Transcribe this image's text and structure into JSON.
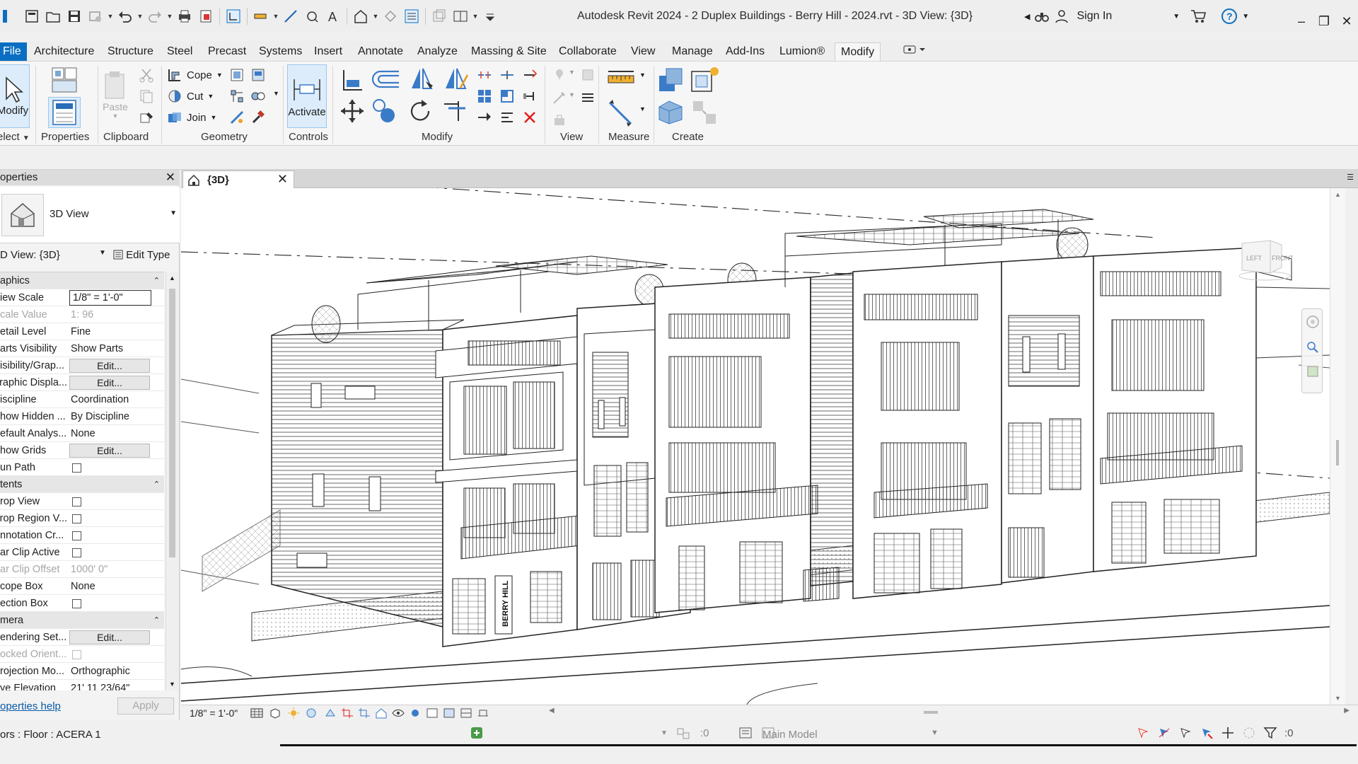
{
  "app": {
    "title": "Autodesk Revit 2024 - 2 Duplex Buildings - Berry Hill - 2024.rvt - 3D View: {3D}",
    "sign_in": "Sign In"
  },
  "ribbon": {
    "tabs": [
      "File",
      "Architecture",
      "Structure",
      "Steel",
      "Precast",
      "Systems",
      "Insert",
      "Annotate",
      "Analyze",
      "Massing & Site",
      "Collaborate",
      "View",
      "Manage",
      "Add-Ins",
      "Lumion®",
      "Modify"
    ],
    "active_tab": "Modify",
    "modify_label": "Modify",
    "select_label": "elect",
    "properties_label": "Properties",
    "paste_label": "Paste",
    "clipboard_label": "Clipboard",
    "cope_label": "Cope",
    "cut_label": "Cut",
    "join_label": "Join",
    "geometry_label": "Geometry",
    "activate_label": "Activate",
    "controls_label": "Controls",
    "modify_panel_label": "Modify",
    "view_panel_label": "View",
    "measure_label": "Measure",
    "create_label": "Create"
  },
  "properties": {
    "header": "operties",
    "type_name": "3D View",
    "view_selector": "D View: {3D}",
    "edit_type": "Edit Type",
    "rows": [
      {
        "kind": "section",
        "name": "aphics"
      },
      {
        "kind": "input",
        "name": "iew Scale",
        "value": "1/8\" = 1'-0\""
      },
      {
        "kind": "text",
        "name": "cale Value",
        "value": "1:  96",
        "grayed": true
      },
      {
        "kind": "text",
        "name": "etail Level",
        "value": "Fine"
      },
      {
        "kind": "text",
        "name": "arts Visibility",
        "value": "Show Parts"
      },
      {
        "kind": "button",
        "name": "isibility/Grap...",
        "value": "Edit..."
      },
      {
        "kind": "button",
        "name": "raphic Displa...",
        "value": "Edit..."
      },
      {
        "kind": "text",
        "name": "iscipline",
        "value": "Coordination"
      },
      {
        "kind": "text",
        "name": "how Hidden ...",
        "value": "By Discipline"
      },
      {
        "kind": "text",
        "name": "efault Analys...",
        "value": "None"
      },
      {
        "kind": "button",
        "name": "how Grids",
        "value": "Edit..."
      },
      {
        "kind": "check",
        "name": "un Path",
        "value": ""
      },
      {
        "kind": "section",
        "name": "tents"
      },
      {
        "kind": "check",
        "name": "rop View",
        "value": ""
      },
      {
        "kind": "check",
        "name": "rop Region V...",
        "value": ""
      },
      {
        "kind": "check",
        "name": "nnotation Cr...",
        "value": ""
      },
      {
        "kind": "check",
        "name": "ar Clip Active",
        "value": ""
      },
      {
        "kind": "text",
        "name": "ar Clip Offset",
        "value": "1000'  0\"",
        "grayed": true
      },
      {
        "kind": "text",
        "name": "cope Box",
        "value": "None"
      },
      {
        "kind": "check",
        "name": "ection Box",
        "value": ""
      },
      {
        "kind": "section",
        "name": "mera"
      },
      {
        "kind": "button",
        "name": "endering Set...",
        "value": "Edit..."
      },
      {
        "kind": "check",
        "name": "ocked Orient...",
        "value": "",
        "grayed": true
      },
      {
        "kind": "text",
        "name": "rojection Mo...",
        "value": "Orthographic"
      },
      {
        "kind": "text",
        "name": "ye Elevation",
        "value": "21'  11 23/64\""
      }
    ],
    "help_link": "operties help",
    "apply": "Apply"
  },
  "view_tab": {
    "label": "{3D}"
  },
  "view_cube": {
    "left": "LEFT",
    "front": "FRONT"
  },
  "view_control": {
    "scale": "1/8\" = 1'-0\""
  },
  "status": {
    "text": "ors : Floor : ACERA 1",
    "worksets_count": ":0",
    "main_model": "Main Model",
    "filter_count": ":0"
  },
  "drawing": {
    "sign_text": "BERRY HILL"
  }
}
